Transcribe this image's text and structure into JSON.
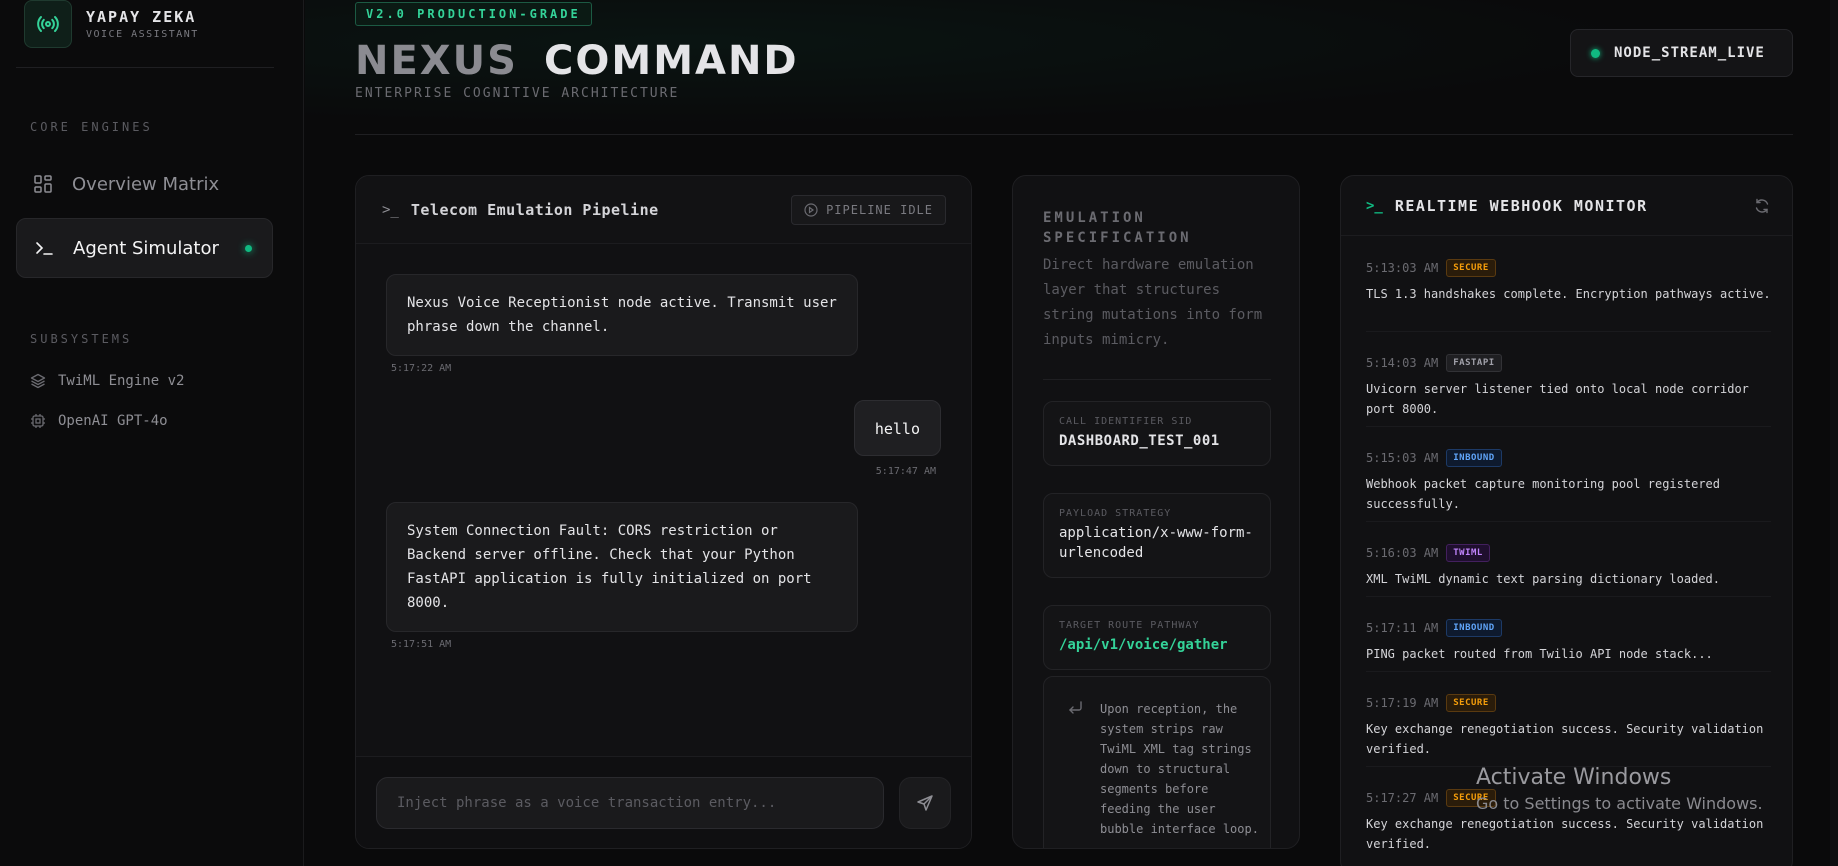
{
  "sidebar": {
    "brand_name": "YAPAY ZEKA",
    "brand_sub": "VOICE ASSISTANT",
    "core_title": "CORE ENGINES",
    "core_items": [
      {
        "label": "Overview Matrix",
        "icon": "grid-icon",
        "active": false
      },
      {
        "label": "Agent Simulator",
        "icon": "terminal-icon",
        "active": true
      }
    ],
    "subsystems_title": "SUBSYSTEMS",
    "subsystems": [
      {
        "label": "TwiML Engine v2",
        "icon": "layers-icon"
      },
      {
        "label": "OpenAI GPT-4o",
        "icon": "cpu-icon"
      }
    ]
  },
  "header": {
    "version": "V2.0 PRODUCTION-GRADE",
    "title_bold": "NEXUS",
    "title_light": "COMMAND",
    "subtitle": "ENTERPRISE COGNITIVE ARCHITECTURE",
    "status": "NODE_STREAM_LIVE"
  },
  "chat": {
    "title": "Telecom Emulation Pipeline",
    "status": "PIPELINE IDLE",
    "messages": [
      {
        "role": "bot",
        "text": "Nexus Voice Receptionist node active. Transmit user phrase down the channel.",
        "time": "5:17:22 AM"
      },
      {
        "role": "user",
        "text": "hello",
        "time": "5:17:47 AM"
      },
      {
        "role": "bot",
        "text": "System Connection Fault: CORS restriction or Backend server offline. Check that your Python FastAPI application is fully initialized on port 8000.",
        "time": "5:17:51 AM"
      }
    ],
    "input_placeholder": "Inject phrase as a voice transaction entry...",
    "input_value": ""
  },
  "spec": {
    "title": "EMULATION SPECIFICATION",
    "description": "Direct hardware emulation layer that structures string mutations into form inputs mimicry.",
    "fields": [
      {
        "label": "CALL IDENTIFIER SID",
        "value": "DASHBOARD_TEST_001"
      },
      {
        "label": "PAYLOAD STRATEGY",
        "value": "application/x-www-form-urlencoded"
      },
      {
        "label": "TARGET ROUTE PATHWAY",
        "value": "/api/v1/voice/gather"
      }
    ],
    "note": "Upon reception, the system strips raw TwiML XML tag strings down to structural segments before feeding the user bubble interface loop."
  },
  "webhook": {
    "title": "REALTIME WEBHOOK MONITOR",
    "logs": [
      {
        "time": "5:13:03 AM",
        "tag": "SECURE",
        "kind": "secure",
        "text": "TLS 1.3 handshakes complete. Encryption pathways active."
      },
      {
        "time": "5:14:03 AM",
        "tag": "FASTAPI",
        "kind": "fastapi",
        "text": "Uvicorn server listener tied onto local node corridor port 8000."
      },
      {
        "time": "5:15:03 AM",
        "tag": "INBOUND",
        "kind": "inbound",
        "text": "Webhook packet capture monitoring pool registered successfully."
      },
      {
        "time": "5:16:03 AM",
        "tag": "TWIML",
        "kind": "twiml",
        "text": "XML TwiML dynamic text parsing dictionary loaded."
      },
      {
        "time": "5:17:11 AM",
        "tag": "INBOUND",
        "kind": "inbound",
        "text": "PING packet routed from Twilio API node stack..."
      },
      {
        "time": "5:17:19 AM",
        "tag": "SECURE",
        "kind": "secure",
        "text": "Key exchange renegotiation success. Security validation verified."
      },
      {
        "time": "5:17:27 AM",
        "tag": "SECURE",
        "kind": "secure",
        "text": "Key exchange renegotiation success. Security validation verified."
      }
    ]
  },
  "watermark": {
    "line1": "Activate Windows",
    "line2": "Go to Settings to activate Windows."
  },
  "colors": {
    "accent": "#10b981",
    "background": "#0a0a0b",
    "secure": "#f59e0b",
    "inbound": "#60a5fa",
    "twiml": "#c084fc"
  }
}
